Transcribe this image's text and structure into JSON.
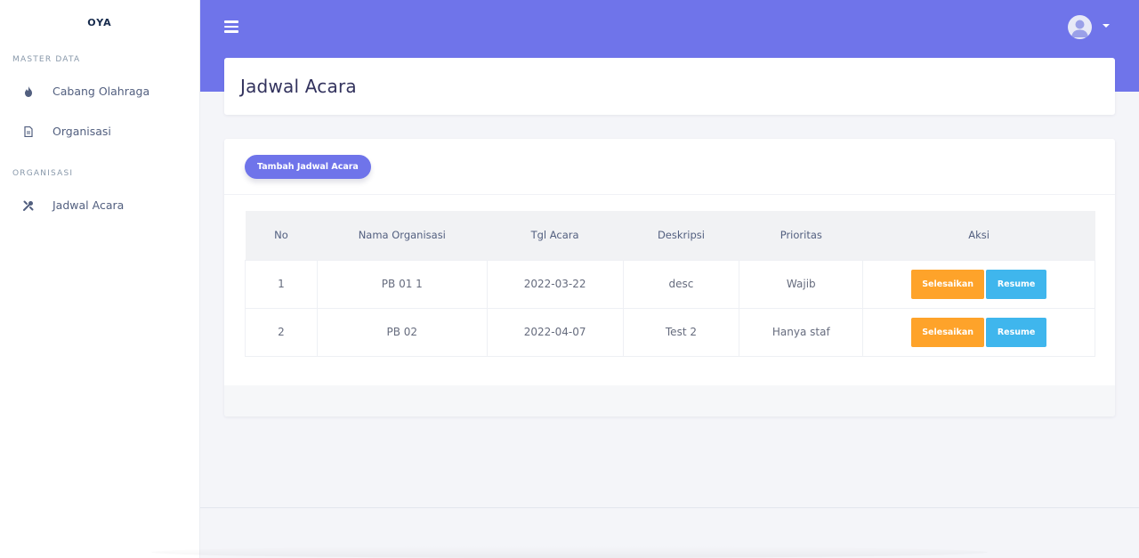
{
  "sidebar": {
    "brand": "OYA",
    "section_master": "MASTER DATA",
    "section_org": "ORGANISASI",
    "items": [
      {
        "label": "Cabang Olahraga",
        "icon": "flame-icon"
      },
      {
        "label": "Organisasi",
        "icon": "document-icon"
      },
      {
        "label": "Jadwal Acara",
        "icon": "tools-icon"
      }
    ]
  },
  "header": {
    "menu_icon": "hamburger-icon",
    "avatar_icon": "user-avatar-icon",
    "accent_color": "#6f74ea"
  },
  "page": {
    "title": "Jadwal Acara"
  },
  "card": {
    "add_button": "Tambah Jadwal Acara"
  },
  "table": {
    "headers": [
      "No",
      "Nama Organisasi",
      "Tgl Acara",
      "Deskripsi",
      "Prioritas",
      "Aksi"
    ],
    "rows": [
      {
        "no": "1",
        "nama": "PB 01 1",
        "tgl": "2022-03-22",
        "deskripsi": "desc",
        "prioritas": "Wajib"
      },
      {
        "no": "2",
        "nama": "PB 02",
        "tgl": "2022-04-07",
        "deskripsi": "Test 2",
        "prioritas": "Hanya staf"
      }
    ],
    "action_finish": "Selesaikan",
    "action_resume": "Resume",
    "finish_color": "#fea32a",
    "resume_color": "#3fb6ed"
  }
}
